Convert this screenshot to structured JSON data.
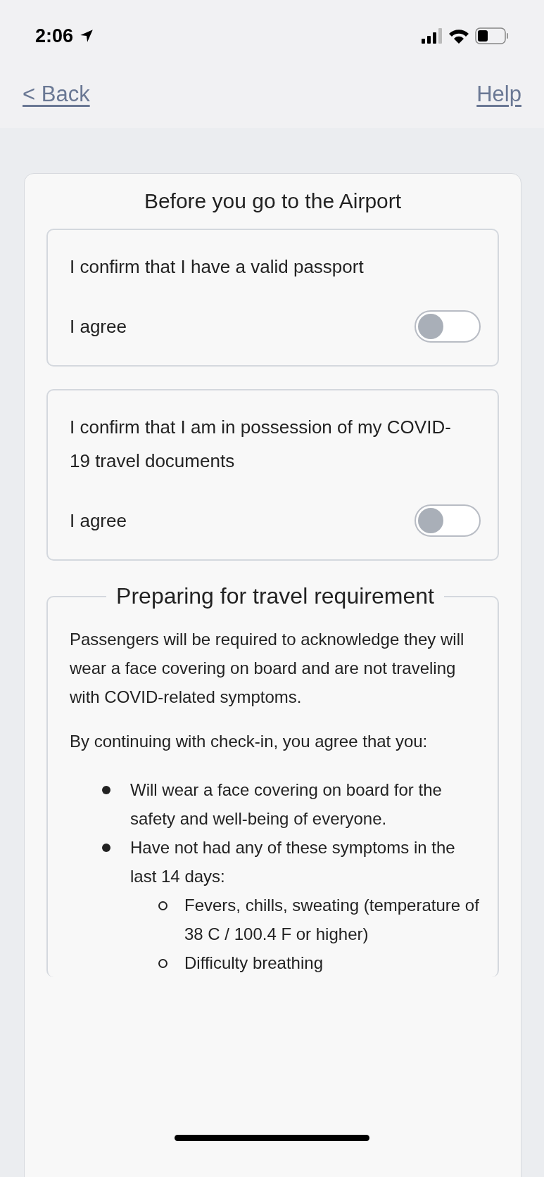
{
  "status_bar": {
    "time": "2:06"
  },
  "nav": {
    "back": "< Back",
    "help": "Help"
  },
  "card": {
    "title": "Before you go to the Airport",
    "confirmations": [
      {
        "text": "I confirm that I have a valid passport",
        "label": "I agree",
        "on": false
      },
      {
        "text": "I confirm that I am in possession of my COVID-19 travel documents",
        "label": "I agree",
        "on": false
      }
    ],
    "requirement": {
      "legend": "Preparing for travel requirement",
      "paragraphs": [
        "Passengers will be required to acknowledge they will wear a face covering on board and are not traveling with COVID-related symptoms.",
        "By continuing with check-in, you agree that you:"
      ],
      "list": [
        {
          "text": "Will wear a face covering on board for the safety and well-being of everyone."
        },
        {
          "text": "Have not had any of these symptoms in the last 14 days:",
          "children": [
            {
              "text": "Fevers, chills, sweating (temperature of 38 C / 100.4 F or higher)"
            },
            {
              "text": "Difficulty breathing"
            }
          ]
        }
      ]
    }
  }
}
